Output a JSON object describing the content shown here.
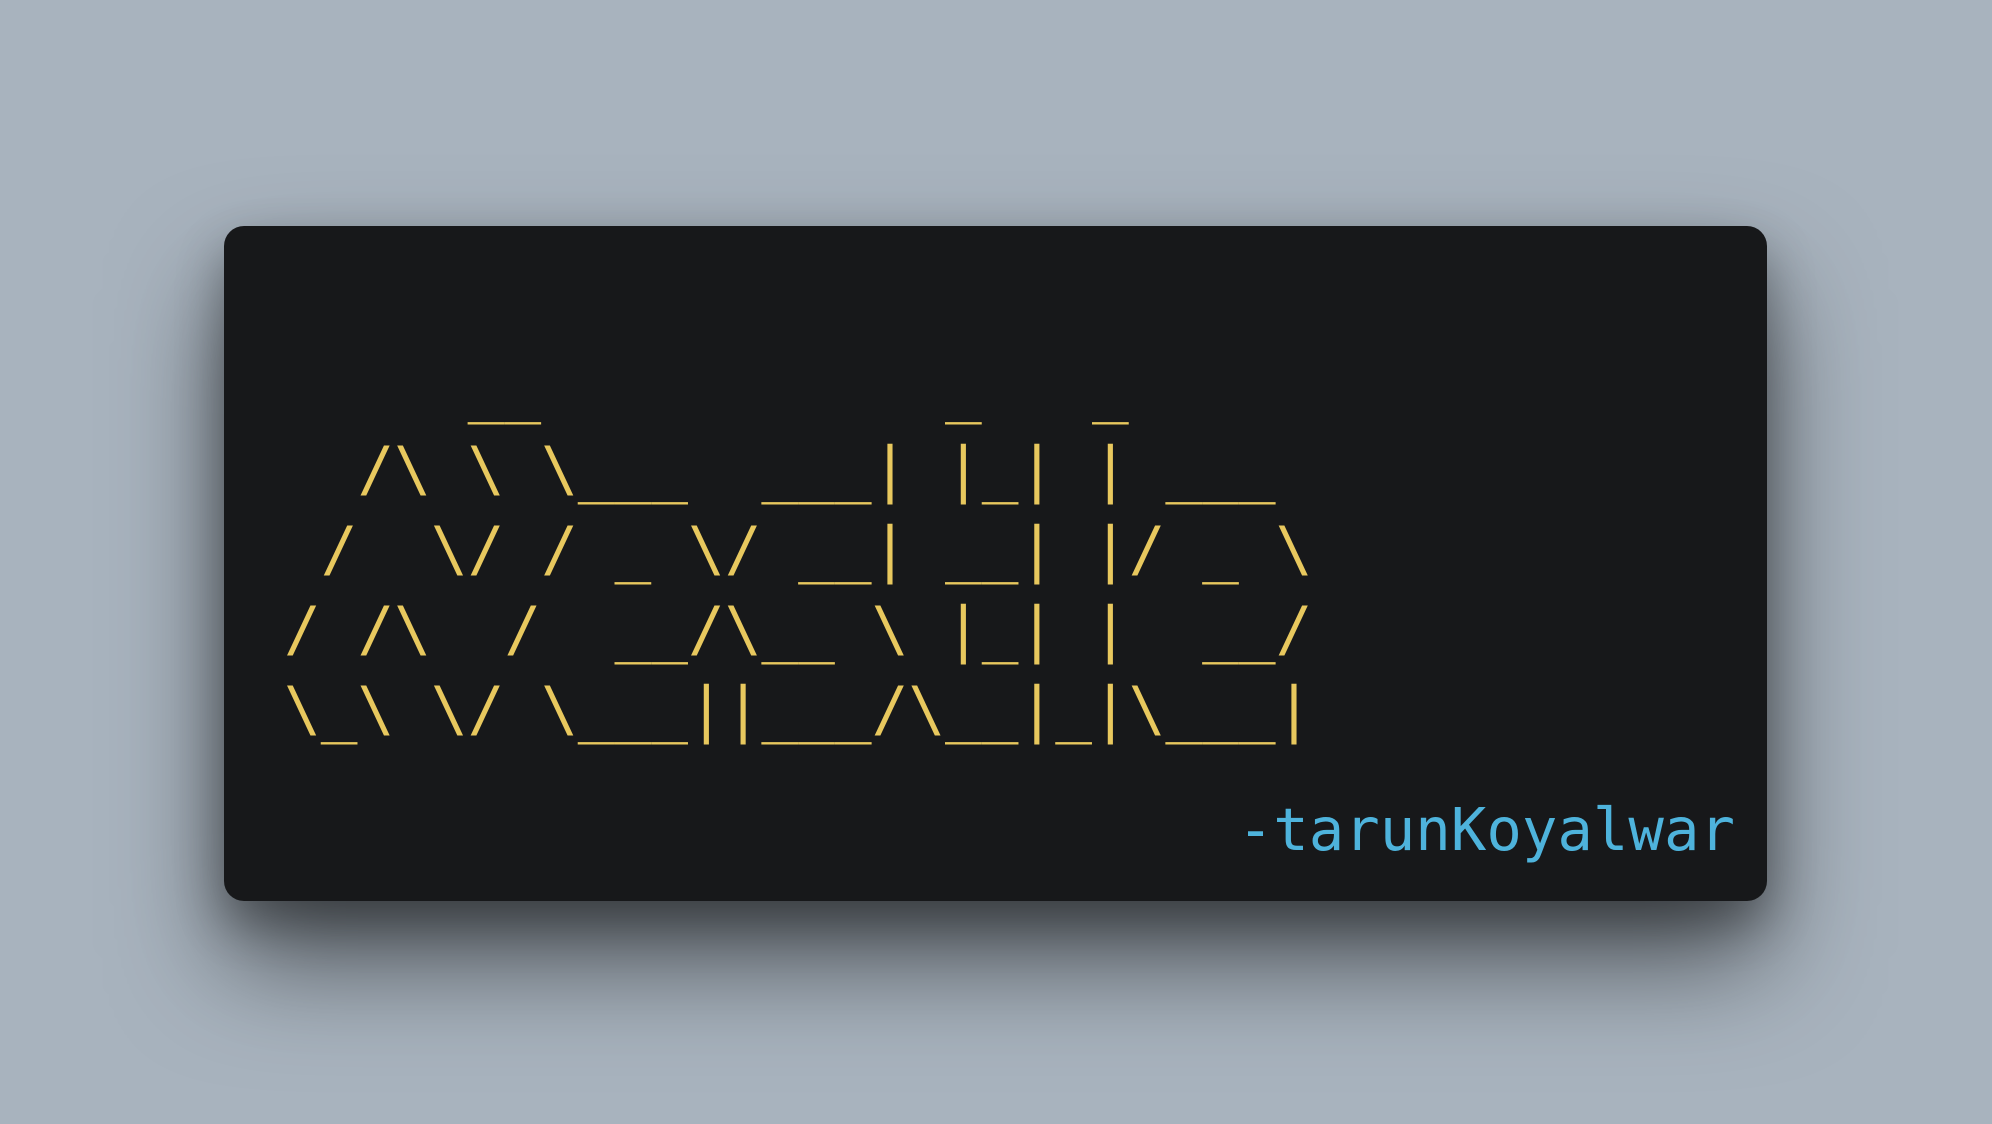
{
  "colors": {
    "background": "#a8b3be",
    "card": "#17181a",
    "ascii_text": "#e8c85e",
    "signature_text": "#4eb3dc"
  },
  "art": {
    "lines": [
      "     __           _   _",
      "  /\\ \\ \\___  ___| |_| | ___",
      " /  \\/ / _ \\/ __| __| |/ _ \\",
      "/ /\\  /  __/\\__ \\ |_| |  __/",
      "\\_\\ \\/ \\___||___/\\__|_|\\___|"
    ]
  },
  "signature": {
    "text": "-tarunKoyalwar"
  }
}
